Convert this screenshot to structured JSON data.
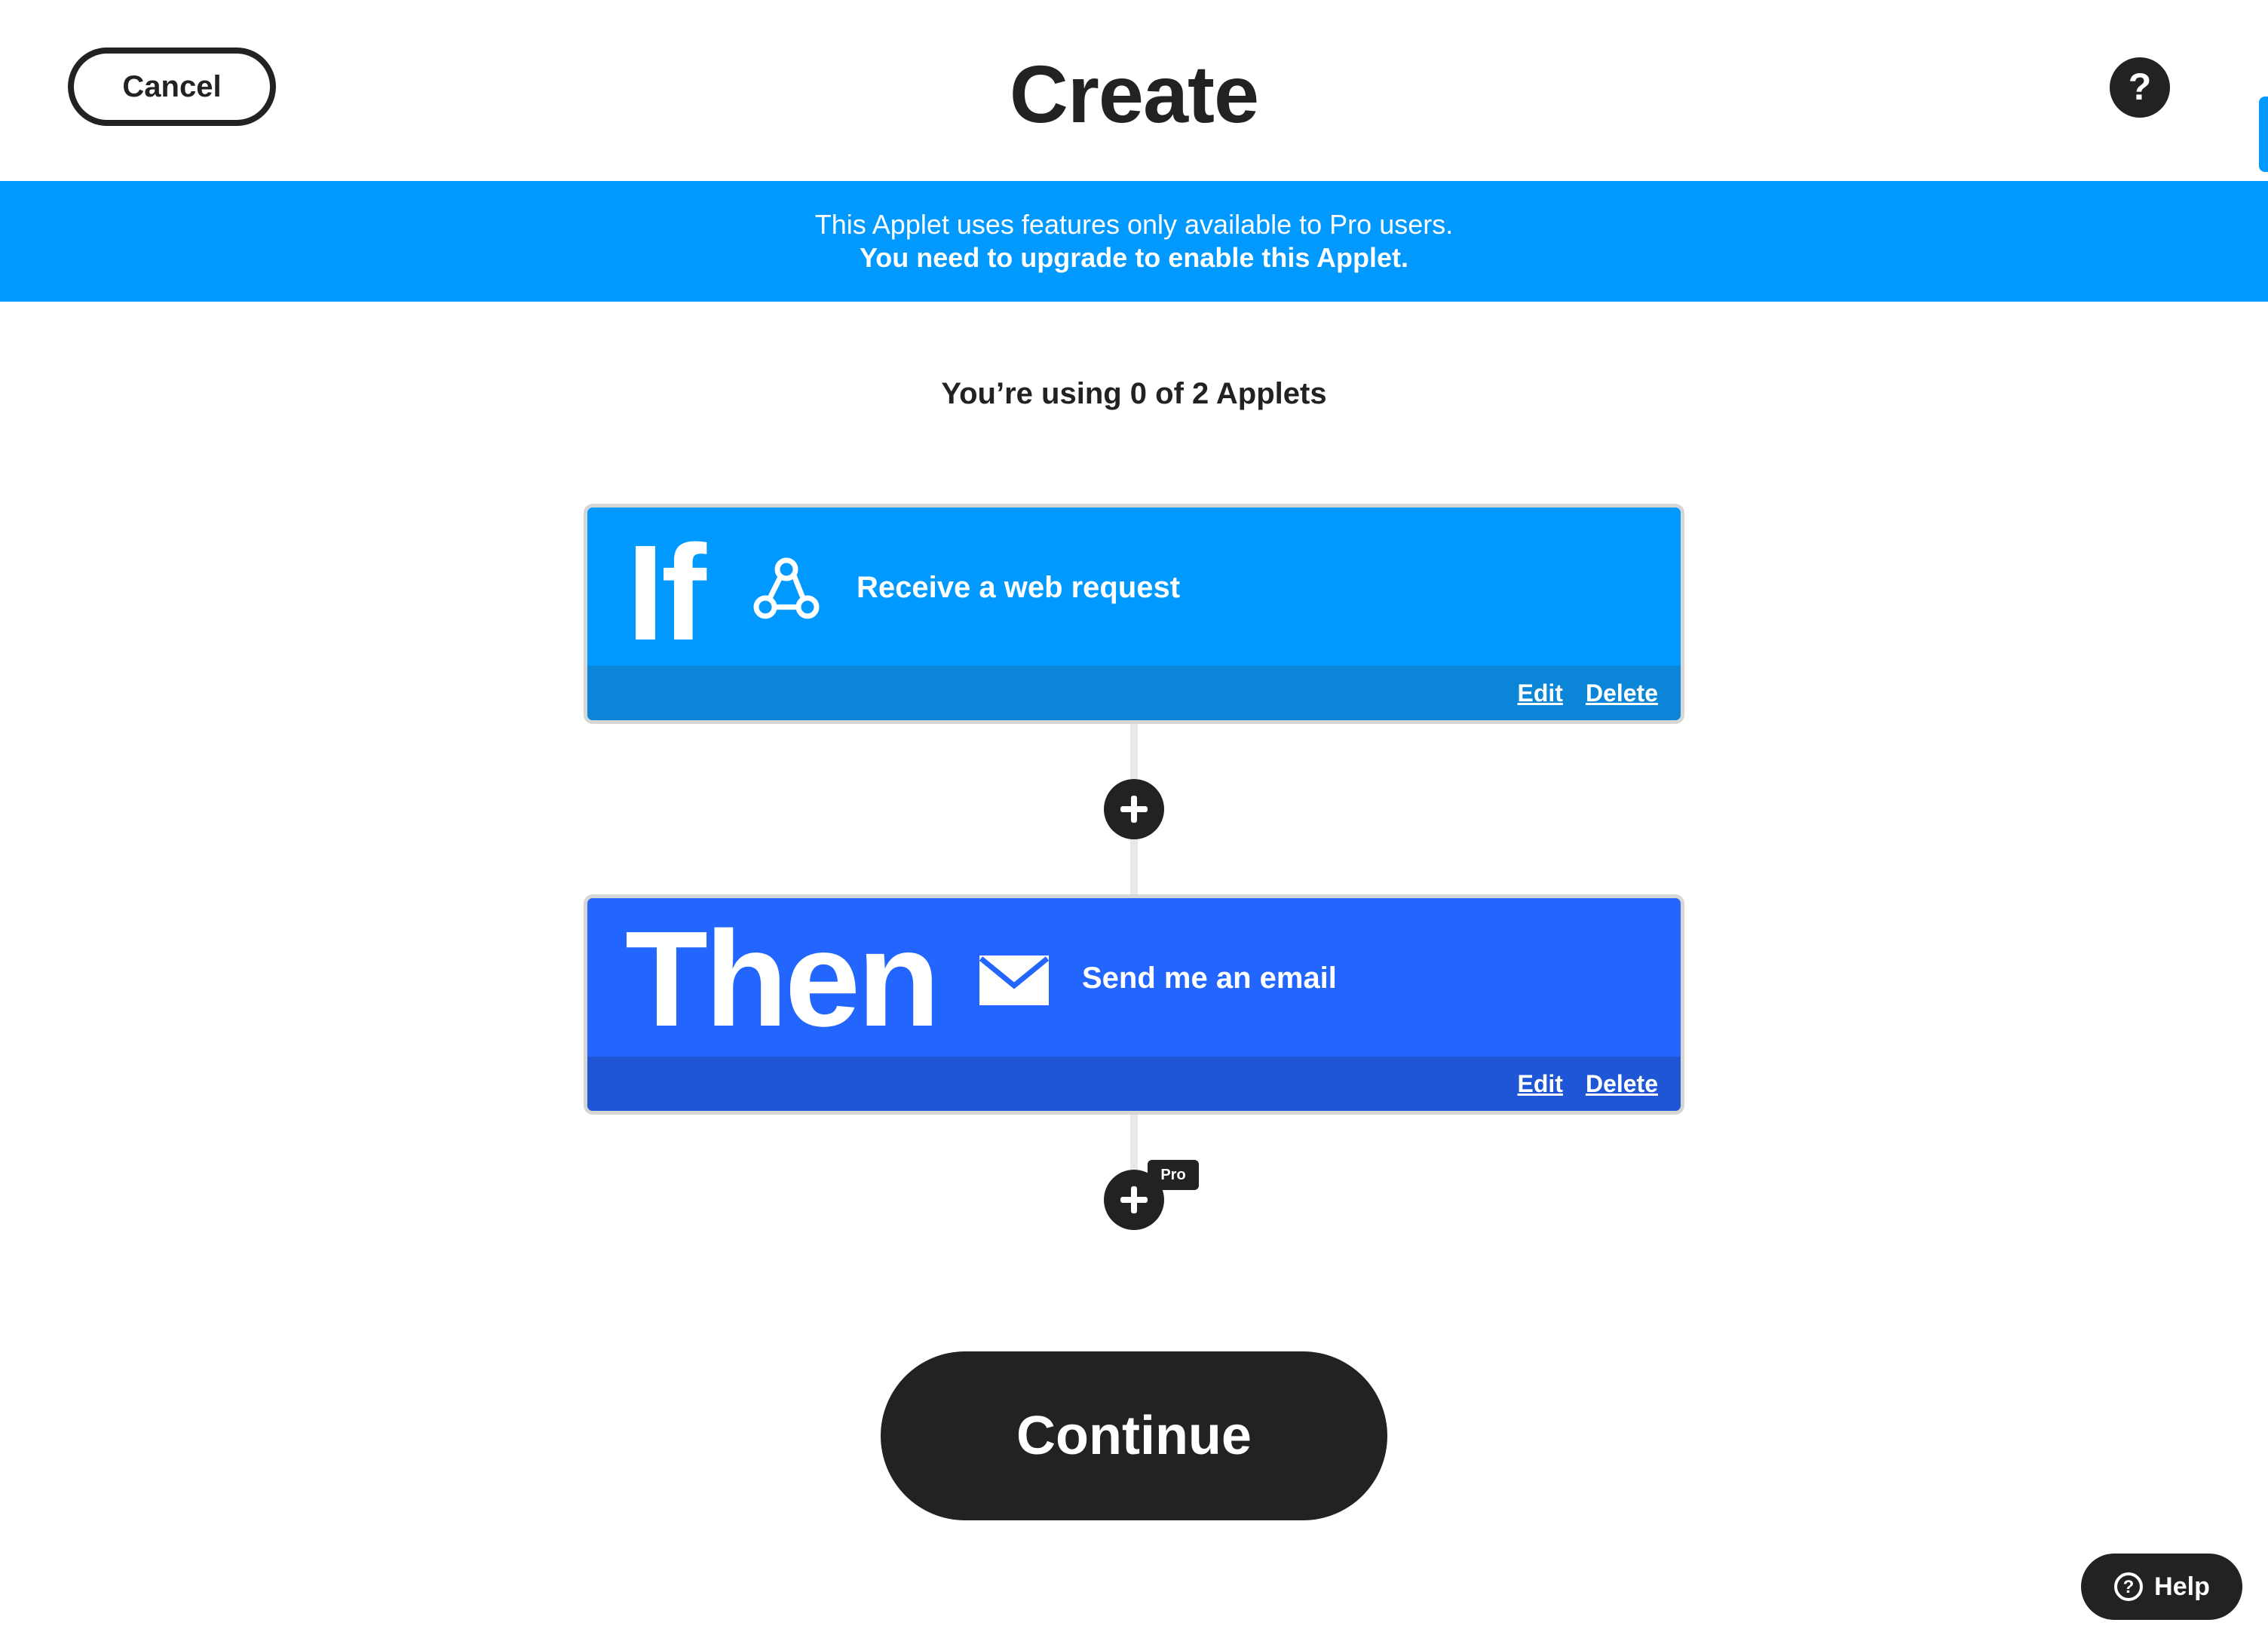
{
  "header": {
    "cancel_label": "Cancel",
    "title": "Create",
    "help_icon": "question-circle-icon"
  },
  "banner": {
    "line1": "This Applet uses features only available to Pro users.",
    "line2": "You need to upgrade to enable this Applet.",
    "color": "#0099ff"
  },
  "usage_text": "You’re using 0 of 2 Applets",
  "if_card": {
    "word": "If",
    "service_icon": "webhook-icon",
    "label": "Receive a web request",
    "edit_label": "Edit",
    "delete_label": "Delete",
    "color": "#0099ff",
    "footer_color": "#0a85d8"
  },
  "then_card": {
    "word": "Then",
    "service_icon": "envelope-icon",
    "label": "Send me an email",
    "edit_label": "Edit",
    "delete_label": "Delete",
    "color": "#2266ff",
    "footer_color": "#1f56d6"
  },
  "add_buttons": [
    {
      "icon": "plus-icon"
    },
    {
      "icon": "plus-icon",
      "badge": "Pro"
    }
  ],
  "continue_label": "Continue",
  "help_button": {
    "icon": "question-circle-icon",
    "label": "Help"
  }
}
